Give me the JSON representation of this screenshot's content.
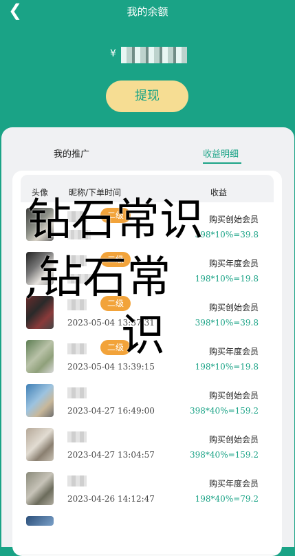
{
  "header": {
    "back_icon": "chevron-left-icon",
    "title": "我的余额",
    "balance_prefix": "¥",
    "withdraw_label": "提现",
    "colors": {
      "primary": "#1aa386",
      "button_bg": "#f6dd93",
      "badge": "#f2a33a"
    }
  },
  "tabs": [
    {
      "label": "我的推广"
    },
    {
      "label": "收益明细"
    }
  ],
  "table": {
    "columns": [
      "头像",
      "昵称/下单时间",
      "收益"
    ],
    "rows": [
      {
        "name": "",
        "badge": "二级",
        "time": "",
        "desc": "购买创始会员",
        "calc": "398*10%=39.8"
      },
      {
        "name": "",
        "badge": "二级",
        "time": "",
        "desc": "购买年度会员",
        "calc": "198*10%=19.8"
      },
      {
        "name": "",
        "badge": "二级",
        "time": "2023-05-04 13:37:31",
        "desc": "购买创始会员",
        "calc": "398*10%=39.8"
      },
      {
        "name": "",
        "badge": "二级",
        "time": "2023-05-04 13:39:15",
        "desc": "购买年度会员",
        "calc": "198*10%=19.8"
      },
      {
        "name": "",
        "badge": "",
        "time": "2023-04-27 16:49:00",
        "desc": "购买创始会员",
        "calc": "398*40%=159.2"
      },
      {
        "name": "",
        "badge": "",
        "time": "2023-04-27 13:04:57",
        "desc": "购买创始会员",
        "calc": "398*40%=159.2"
      },
      {
        "name": "",
        "badge": "",
        "time": "2023-04-26 14:12:47",
        "desc": "购买年度会员",
        "calc": "198*40%=79.2"
      }
    ]
  },
  "overlay_text": {
    "line1": "钻石常识",
    "line2": ",钻石常",
    "line3": "识"
  }
}
